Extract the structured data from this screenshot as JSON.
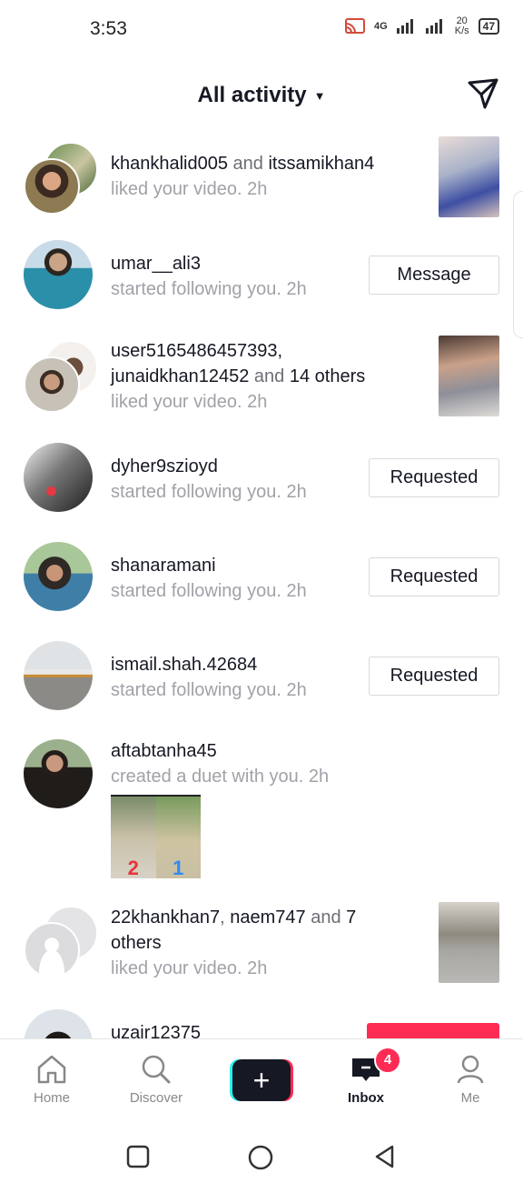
{
  "status": {
    "time": "3:53",
    "network": "4G",
    "speed": "20",
    "speed_unit": "K/s",
    "battery": "47"
  },
  "header": {
    "title": "All activity"
  },
  "activity": [
    {
      "user1": "khankhalid005",
      "conj": " and ",
      "user2": "itssamikhan4",
      "action": "liked your video.",
      "time": "2h"
    },
    {
      "user1": "umar__ali3",
      "action": "started following you.",
      "time": "2h",
      "button": "Message"
    },
    {
      "user1": "user5165486457393,",
      "user2": "junaidkhan12452",
      "conj": " and ",
      "others": "14 others",
      "action": "liked your video.",
      "time": "2h"
    },
    {
      "user1": "dyher9szioyd",
      "action": "started following you.",
      "time": "2h",
      "button": "Requested"
    },
    {
      "user1": "shanaramani",
      "action": "started following you.",
      "time": "2h",
      "button": "Requested"
    },
    {
      "user1": "ismail.shah.42684",
      "action": "started following you.",
      "time": "2h",
      "button": "Requested"
    },
    {
      "user1": "aftabtanha45",
      "action": "created a duet with you.",
      "time": "2h",
      "duet_left": "2",
      "duet_right": "1"
    },
    {
      "user1": "22khankhan7",
      "sep": ", ",
      "user2": "naem747",
      "conj": " and ",
      "others_a": "7",
      "others_b": "others",
      "action": "liked your video.",
      "time": "2h"
    },
    {
      "user1": "uzair12375"
    }
  ],
  "tabs": {
    "home": "Home",
    "discover": "Discover",
    "inbox": "Inbox",
    "inbox_badge": "4",
    "me": "Me"
  },
  "colors": {
    "accent": "#fe2c55",
    "cyan": "#25f4ee",
    "muted": "#a0a2a8"
  }
}
